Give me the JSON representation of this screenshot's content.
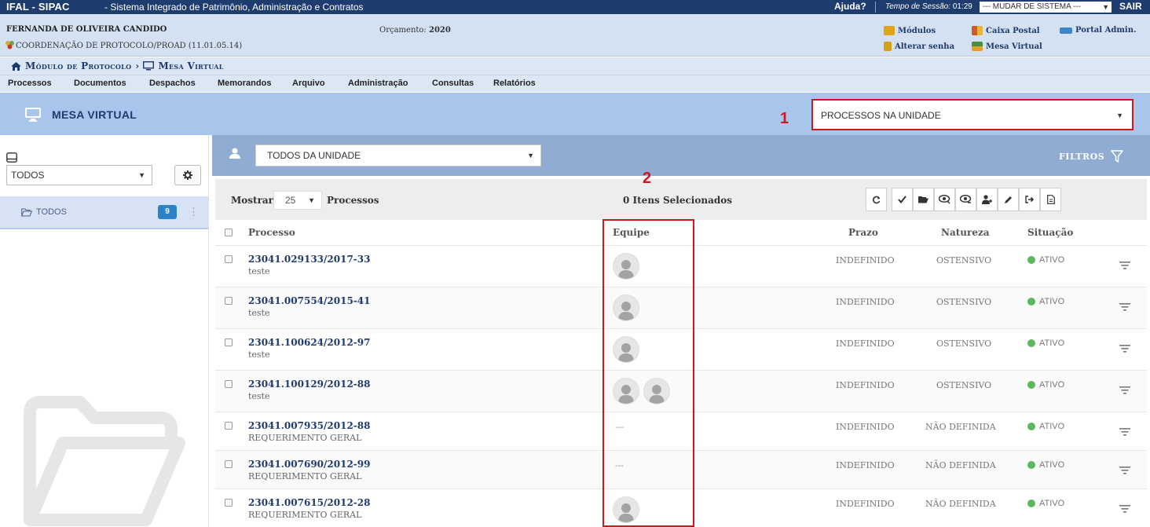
{
  "topbar": {
    "brand": "IFAL - SIPAC",
    "system_name": "- Sistema Integrado de Patrimônio, Administração e Contratos",
    "help": "Ajuda?",
    "session_label": "Tempo de Sessão:",
    "session_time": "01:29",
    "system_select": "--- MUDAR DE SISTEMA ---",
    "logout": "SAIR"
  },
  "user": {
    "name": "FERNANDA DE OLIVEIRA CANDIDO",
    "unit": "COORDENAÇÃO DE PROTOCOLO/PROAD (11.01.05.14)",
    "budget_label": "Orçamento:",
    "budget_year": "2020"
  },
  "user_links": {
    "modules": "Módulos",
    "inbox": "Caixa Postal",
    "portal_admin": "Portal Admin.",
    "change_password": "Alterar senha",
    "virtual_desk": "Mesa Virtual"
  },
  "breadcrumb": {
    "module": "Módulo de Protocolo",
    "page": "Mesa Virtual",
    "separator": "›"
  },
  "menu": [
    "Processos",
    "Documentos",
    "Despachos",
    "Memorandos",
    "Arquivo",
    "Administração",
    "Consultas",
    "Relatórios"
  ],
  "module_header": {
    "title": "MESA VIRTUAL",
    "view_select": "PROCESSOS NA UNIDADE",
    "annotation_1": "1"
  },
  "sidebar": {
    "filter_select": "TODOS",
    "item_label": "TODOS",
    "item_count": "9"
  },
  "filterbar": {
    "team_select": "TODOS DA UNIDADE",
    "filters_label": "FILTROS"
  },
  "table_toolbar": {
    "show_label": "Mostrar",
    "page_size": "25",
    "items_label": "Processos",
    "selected_count": "0 Itens Selecionados",
    "annotation_2": "2"
  },
  "columns": {
    "process": "Processo",
    "team": "Equipe",
    "deadline": "Prazo",
    "nature": "Natureza",
    "status": "Situação"
  },
  "rows": [
    {
      "number": "23041.029133/2017-33",
      "desc": "teste",
      "team": "avatar",
      "avatars": 1,
      "deadline": "INDEFINIDO",
      "nature": "OSTENSIVO",
      "status": "ATIVO"
    },
    {
      "number": "23041.007554/2015-41",
      "desc": "teste",
      "team": "avatar",
      "avatars": 1,
      "deadline": "INDEFINIDO",
      "nature": "OSTENSIVO",
      "status": "ATIVO"
    },
    {
      "number": "23041.100624/2012-97",
      "desc": "teste",
      "team": "avatar",
      "avatars": 1,
      "deadline": "INDEFINIDO",
      "nature": "OSTENSIVO",
      "status": "ATIVO"
    },
    {
      "number": "23041.100129/2012-88",
      "desc": "teste",
      "team": "avatar",
      "avatars": 2,
      "deadline": "INDEFINIDO",
      "nature": "OSTENSIVO",
      "status": "ATIVO"
    },
    {
      "number": "23041.007935/2012-88",
      "desc": "REQUERIMENTO GERAL",
      "team": "---",
      "avatars": 0,
      "deadline": "INDEFINIDO",
      "nature": "NÃO DEFINIDA",
      "status": "ATIVO"
    },
    {
      "number": "23041.007690/2012-99",
      "desc": "REQUERIMENTO GERAL",
      "team": "---",
      "avatars": 0,
      "deadline": "INDEFINIDO",
      "nature": "NÃO DEFINIDA",
      "status": "ATIVO"
    },
    {
      "number": "23041.007615/2012-28",
      "desc": "REQUERIMENTO GERAL",
      "team": "avatar",
      "avatars": 1,
      "deadline": "INDEFINIDO",
      "nature": "NÃO DEFINIDA",
      "status": "ATIVO"
    }
  ],
  "colors": {
    "topbar": "#1e3d6e",
    "header_blue": "#a8c6ec",
    "filterbar": "#90acd2",
    "annotation_red": "#d3141c",
    "status_green": "#5cb85c",
    "link_blue": "#1f3b6e"
  },
  "icons": {
    "monitor": "monitor-icon",
    "home": "home-icon",
    "gear": "gear-icon",
    "folder": "folder-icon",
    "inbox": "inbox-icon",
    "user": "user-icon",
    "filter": "filter-icon",
    "row_menu": "row-menu-icon"
  }
}
